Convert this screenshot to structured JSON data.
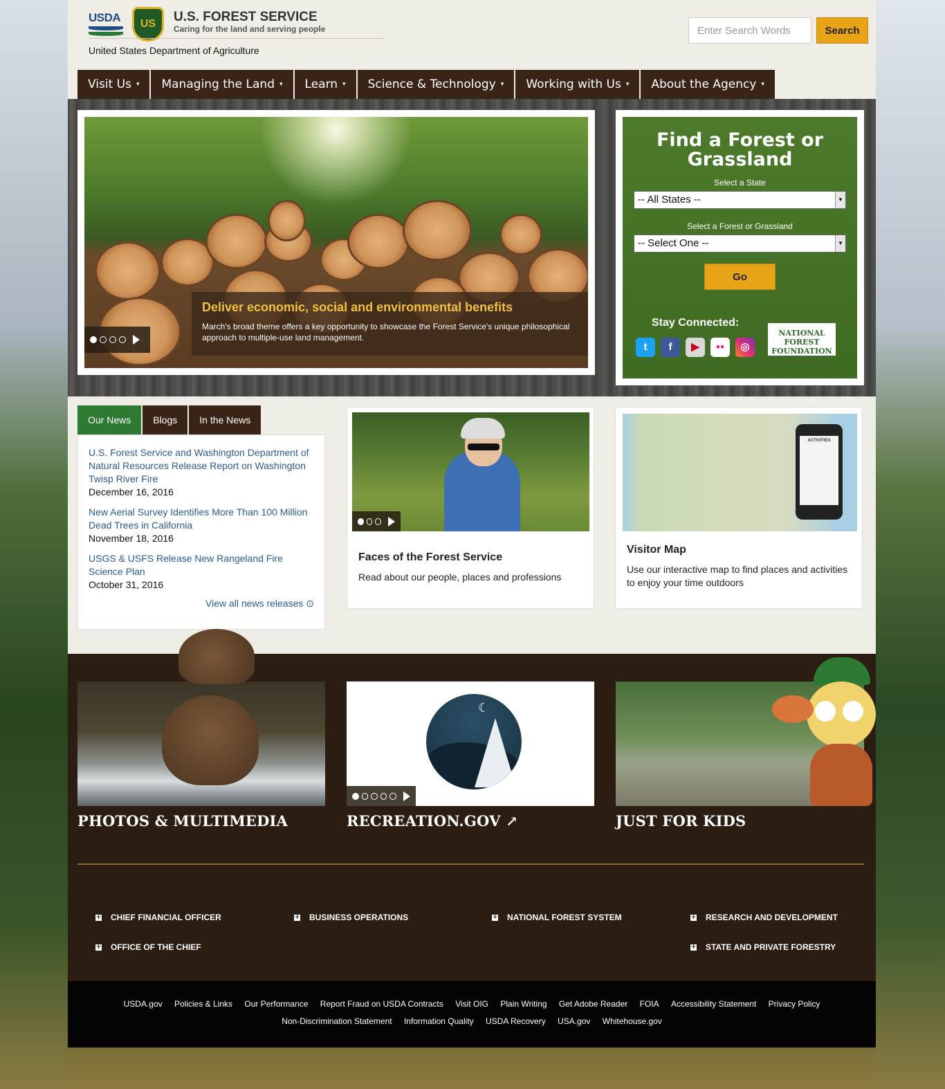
{
  "header": {
    "usda_logo": "USDA",
    "shield_logo": "US",
    "agency_name": "U.S. FOREST SERVICE",
    "tagline": "Caring for the land and serving people",
    "department": "United States Department of Agriculture",
    "search_placeholder": "Enter Search Words",
    "search_button": "Search"
  },
  "nav": {
    "items": [
      {
        "label": "Visit Us"
      },
      {
        "label": "Managing the Land"
      },
      {
        "label": "Learn"
      },
      {
        "label": "Science & Technology"
      },
      {
        "label": "Working with Us"
      },
      {
        "label": "About the Agency"
      }
    ],
    "caret": "▾"
  },
  "hero": {
    "slide_title": "Deliver economic, social and environmental benefits",
    "slide_text": "March's broad theme offers a key opportunity to showcase the Forest Service's unique philosophical approach to multiple-use land management.",
    "slide_count": 4,
    "active_slide": 1
  },
  "finder": {
    "title": "Find a Forest or Grassland",
    "state_label": "Select a State",
    "state_value": "-- All States --",
    "forest_label": "Select a Forest or Grassland",
    "forest_value": "-- Select One --",
    "go_button": "Go",
    "stay_connected": "Stay Connected:",
    "social": [
      {
        "icon": "twitter-icon",
        "glyph": "t",
        "color": "#1da1f2"
      },
      {
        "icon": "facebook-icon",
        "glyph": "f",
        "color": "#3b5998"
      },
      {
        "icon": "youtube-icon",
        "glyph": "▶",
        "color": "#d8d8d8"
      },
      {
        "icon": "flickr-icon",
        "glyph": "●●",
        "color": "#ffffff"
      },
      {
        "icon": "instagram-icon",
        "glyph": "◎",
        "color": "#c13584"
      }
    ],
    "partner_logo": "NATIONAL FOREST FOUNDATION"
  },
  "news": {
    "tabs": [
      "Our News",
      "Blogs",
      "In the News"
    ],
    "items": [
      {
        "title": "U.S. Forest Service and Washington Department of Natural Resources Release Report on Washington Twisp River Fire",
        "date": "December 16, 2016"
      },
      {
        "title": "New Aerial Survey Identifies More Than 100 Million Dead Trees in California",
        "date": "November 18, 2016"
      },
      {
        "title": "USGS & USFS Release New Rangeland Fire Science Plan",
        "date": "October 31, 2016"
      }
    ],
    "view_all": "View all news releases"
  },
  "faces": {
    "title": "Faces of the Forest Service",
    "text": "Read about our people, places and professions",
    "slide_count": 3
  },
  "visitor_map": {
    "title": "Visitor Map",
    "text": "Use our interactive map to find places and activities to enjoy your time outdoors",
    "phone_label": "ACTIVITIES"
  },
  "features": {
    "photos": "PHOTOS & MULTIMEDIA",
    "recreation": "RECREATION.GOV",
    "recreation_slide_count": 5,
    "kids": "JUST FOR KIDS"
  },
  "quick_links": [
    "CHIEF FINANCIAL OFFICER",
    "BUSINESS OPERATIONS",
    "NATIONAL FOREST SYSTEM",
    "RESEARCH AND DEVELOPMENT",
    "OFFICE OF THE CHIEF",
    "STATE AND PRIVATE FORESTRY"
  ],
  "footer": {
    "row1": [
      "USDA.gov",
      "Policies & Links",
      "Our Performance",
      "Report Fraud on USDA Contracts",
      "Visit OIG",
      "Plain Writing",
      "Get Adobe Reader",
      "FOIA",
      "Accessibility Statement",
      "Privacy Policy"
    ],
    "row2": [
      "Non-Discrimination Statement",
      "Information Quality",
      "USDA Recovery",
      "USA.gov",
      "Whitehouse.gov"
    ]
  }
}
